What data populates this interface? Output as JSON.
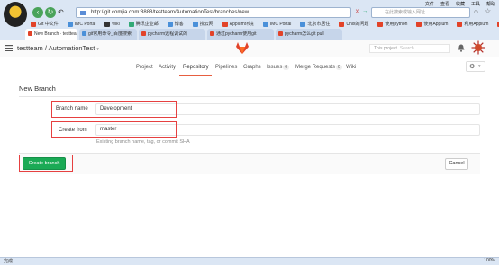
{
  "browser": {
    "menu": [
      "文件",
      "查看",
      "收藏",
      "工具",
      "帮助"
    ],
    "url": "http://git.comjia.com:8888/testteam/AutomationTest/branches/new",
    "search_placeholder": "在此搜索或输入网址",
    "bookmarks": [
      "Git 中文件",
      "IMC Portal",
      "wiki",
      "腾讯企业邮",
      "博客",
      "搜云网",
      "Appium环境",
      "IMC Portal",
      "北京市居住",
      "Unix的问题",
      "使用python",
      "使用Appium",
      "利用Appium",
      "appius"
    ],
    "tabs": [
      "New Branch · testtea",
      "git常用命令_百度搜索",
      "pycharm远程调试的",
      "通过pycharm使用git",
      "pycharm怎么git pull"
    ],
    "status_text": "完成",
    "zoom": "100%"
  },
  "header": {
    "project_title": "testteam / AutomationTest",
    "search_label": "This project",
    "search_placeholder": "Search"
  },
  "subnav": {
    "items": [
      "Project",
      "Activity",
      "Repository",
      "Pipelines",
      "Graphs",
      "Issues",
      "Merge Requests",
      "Wiki"
    ],
    "issues_count": "0",
    "mr_count": "0",
    "active": "Repository"
  },
  "form": {
    "title": "New Branch",
    "branch_name_label": "Branch name",
    "branch_name_value": "Development",
    "create_from_label": "Create from",
    "create_from_value": "master",
    "help_text": "Existing branch name, tag, or commit SHA",
    "create_button": "Create branch",
    "cancel_button": "Cancel"
  },
  "colors": {
    "accent": "#e75e40",
    "create_button": "#1aaa55",
    "highlight_box": "#e64040"
  }
}
